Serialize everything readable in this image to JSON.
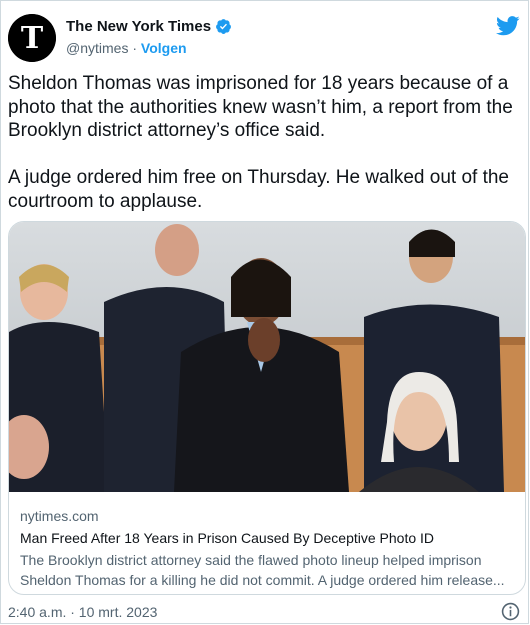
{
  "account": {
    "name": "The New York Times",
    "handle": "@nytimes",
    "separator": "·",
    "follow_label": "Volgen",
    "verified_icon": "verified-badge-icon",
    "avatar_icon": "nyt-logo-icon"
  },
  "platform_icon": "twitter-bird-icon",
  "tweet": {
    "text": "Sheldon Thomas was imprisoned for 18 years because of a photo that the authorities knew wasn’t him, a report from the Brooklyn district attorney’s office said.\n\nA judge ordered him free on Thursday. He walked out of the courtroom to applause."
  },
  "card": {
    "image_icon": "courtroom-photo",
    "domain": "nytimes.com",
    "title": "Man Freed After 18 Years in Prison Caused By Deceptive Photo ID",
    "description": "The Brooklyn district attorney said the flawed photo lineup helped imprison Sheldon Thomas for a killing he did not commit. A judge ordered him release..."
  },
  "footer": {
    "timestamp": "2:40 a.m. · 10 mrt. 2023",
    "info_icon": "info-icon"
  },
  "colors": {
    "accent": "#1d9bf0",
    "text": "#0f1419",
    "secondary": "#536471",
    "border": "#cfd9de"
  }
}
